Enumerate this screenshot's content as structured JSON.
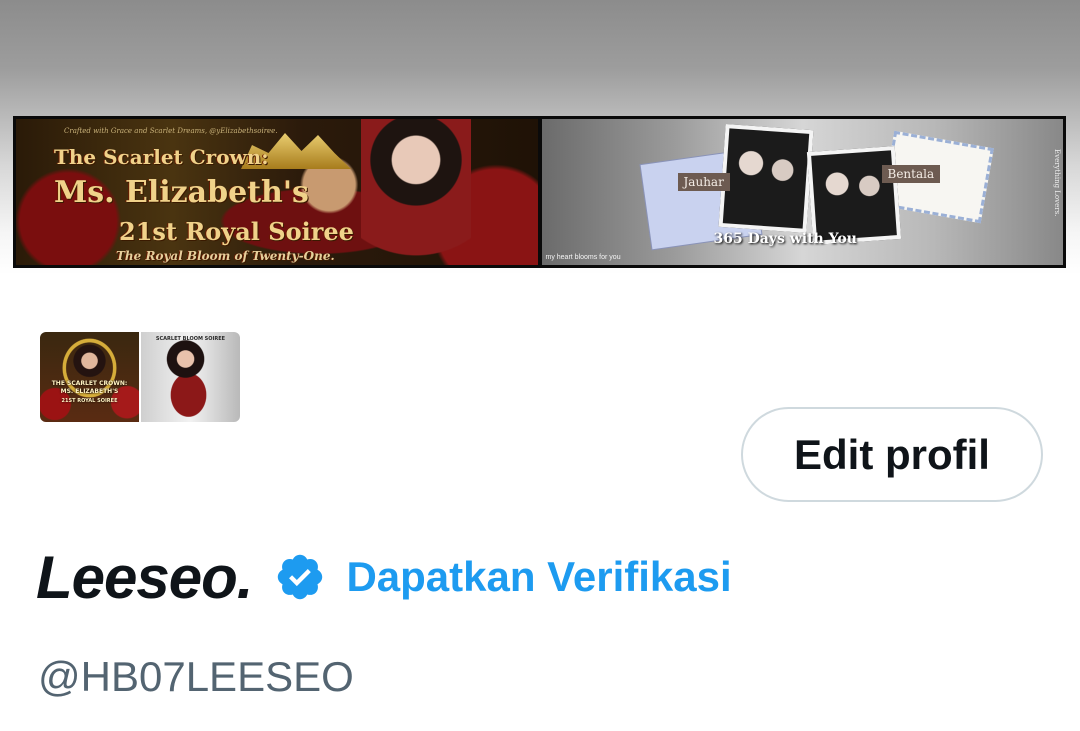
{
  "header": {
    "banner": {
      "left_panel": {
        "credit": "Crafted with Grace and Scarlet Dreams, @yElizabethsoiree.",
        "title_line1": "The Scarlet Crown:",
        "title_line2": "Ms. Elizabeth's",
        "title_line3": "21st Royal Soiree",
        "subtitle": "The Royal Bloom of Twenty-One."
      },
      "right_panel": {
        "name_left": "Jauhar",
        "name_right": "Bentala",
        "title": "365 Days with You",
        "small_caption": "my heart blooms for you",
        "side_caption": "Everything Lovers."
      }
    }
  },
  "profile": {
    "avatar": {
      "left_text_1": "THE SCARLET CROWN:",
      "left_text_2": "MS. ELIZABETH'S",
      "left_text_3": "21ST ROYAL SOIREE",
      "right_text": "SCARLET BLOOM SOIREE"
    },
    "edit_button_label": "Edit profil",
    "display_name": "Leeseo.",
    "verify_label": "Dapatkan Verifikasi",
    "handle": "@HB07LEESEO"
  },
  "colors": {
    "accent": "#1d9bf0",
    "text_primary": "#0f1419",
    "text_secondary": "#536471",
    "button_border": "#cfd9de"
  },
  "icons": {
    "verified": "verified-badge-icon"
  }
}
